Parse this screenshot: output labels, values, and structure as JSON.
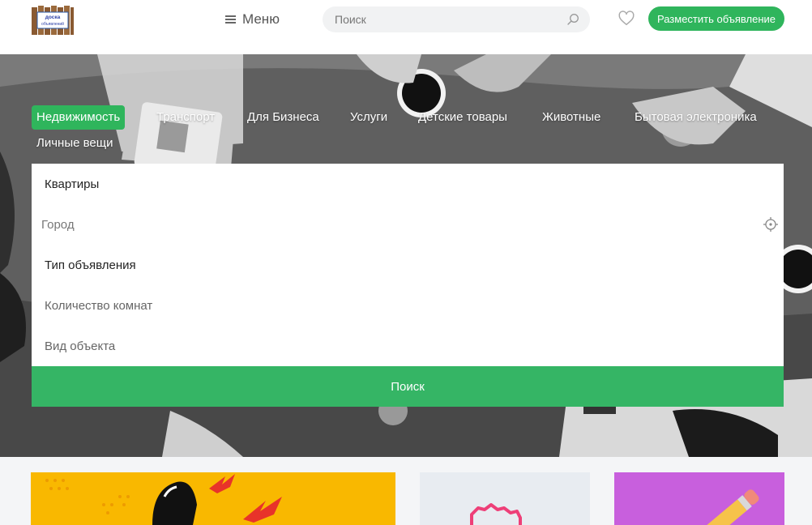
{
  "header": {
    "logo_text": [
      "доска",
      "объявлений"
    ],
    "menu_label": "Меню",
    "search_placeholder": "Поиск",
    "post_button_label": "Разместить объявление"
  },
  "categories": [
    {
      "label": "Недвижимость",
      "active": true
    },
    {
      "label": "Транспорт",
      "active": false
    },
    {
      "label": "Для Бизнеса",
      "active": false
    },
    {
      "label": "Услуги",
      "active": false
    },
    {
      "label": "Детские товары",
      "active": false
    },
    {
      "label": "Животные",
      "active": false
    },
    {
      "label": "Бытовая электроника",
      "active": false
    },
    {
      "label": "Личные вещи",
      "active": false
    }
  ],
  "search_form": {
    "subcategory": "Квартиры",
    "city_placeholder": "Город",
    "listing_type": "Тип объявления",
    "rooms": "Количество комнат",
    "object_type": "Вид объекта",
    "submit_label": "Поиск"
  },
  "colors": {
    "accent": "#2fb55c",
    "card1": "#f9b800",
    "card2": "#e8ecf1",
    "card3": "#c85fdd"
  },
  "icons": {
    "menu": "hamburger-icon",
    "search": "magnifier-icon",
    "favorite": "heart-icon",
    "location": "crosshair-icon"
  }
}
